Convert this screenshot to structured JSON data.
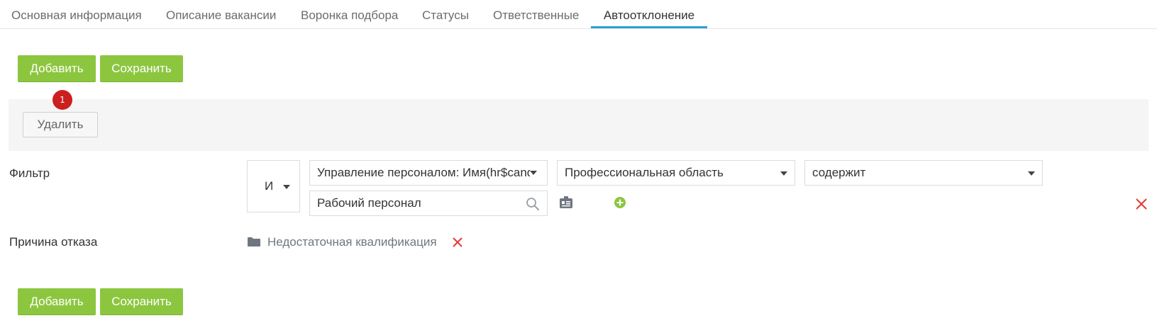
{
  "tabs": [
    {
      "label": "Основная информация"
    },
    {
      "label": "Описание вакансии"
    },
    {
      "label": "Воронка подбора"
    },
    {
      "label": "Статусы"
    },
    {
      "label": "Ответственные"
    },
    {
      "label": "Автоотклонение",
      "active": true
    }
  ],
  "toolbar_top": {
    "add_label": "Добавить",
    "save_label": "Сохранить"
  },
  "rule": {
    "badge": "1",
    "delete_label": "Удалить",
    "filter_label": "Фильтр",
    "logic_operator": "И",
    "field_select": "Управление персоналом: Имя(hr$candidate)",
    "attribute_select": "Профессиональная область",
    "condition_select": "содержит",
    "value_input": "Рабочий персонал",
    "reason_label": "Причина отказа",
    "reason_value": "Недостаточная квалификация"
  },
  "toolbar_bottom": {
    "add_label": "Добавить",
    "save_label": "Сохранить"
  },
  "colors": {
    "accent_green": "#8cc63f",
    "tab_underline": "#2a9fd6",
    "delete_red": "#e53935",
    "badge_red": "#cc1f1f"
  },
  "icons": [
    "search-icon",
    "id-card-icon",
    "plus-circle-icon",
    "close-icon",
    "folder-icon"
  ]
}
